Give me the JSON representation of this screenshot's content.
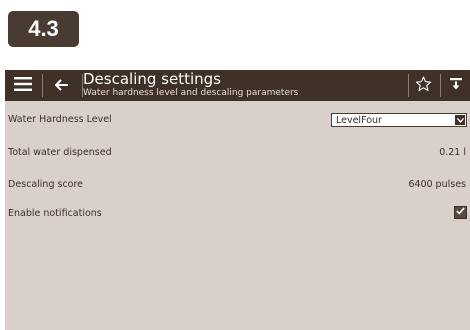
{
  "badge": {
    "text": "4.3"
  },
  "topbar": {
    "title": "Descaling settings",
    "subtitle": "Water hardness level and descaling parameters",
    "menu_icon": "hamburger-menu-icon",
    "back_icon": "arrow-left-icon",
    "star_icon": "star-outline-icon",
    "download_icon": "download-icon"
  },
  "settings": {
    "water_hardness": {
      "label": "Water Hardness Level",
      "selected": "LevelFour"
    },
    "total_water": {
      "label": "Total water dispensed",
      "value": "0.21 l"
    },
    "descaling_score": {
      "label": "Descaling score",
      "value": "6400 pulses"
    },
    "notifications": {
      "label": "Enable notifications",
      "checked": true
    }
  },
  "colors": {
    "topbar_bg": "#3f3128",
    "panel_bg": "#d9d0cb",
    "badge_bg": "#4a3b32",
    "text": "#3b302a"
  }
}
